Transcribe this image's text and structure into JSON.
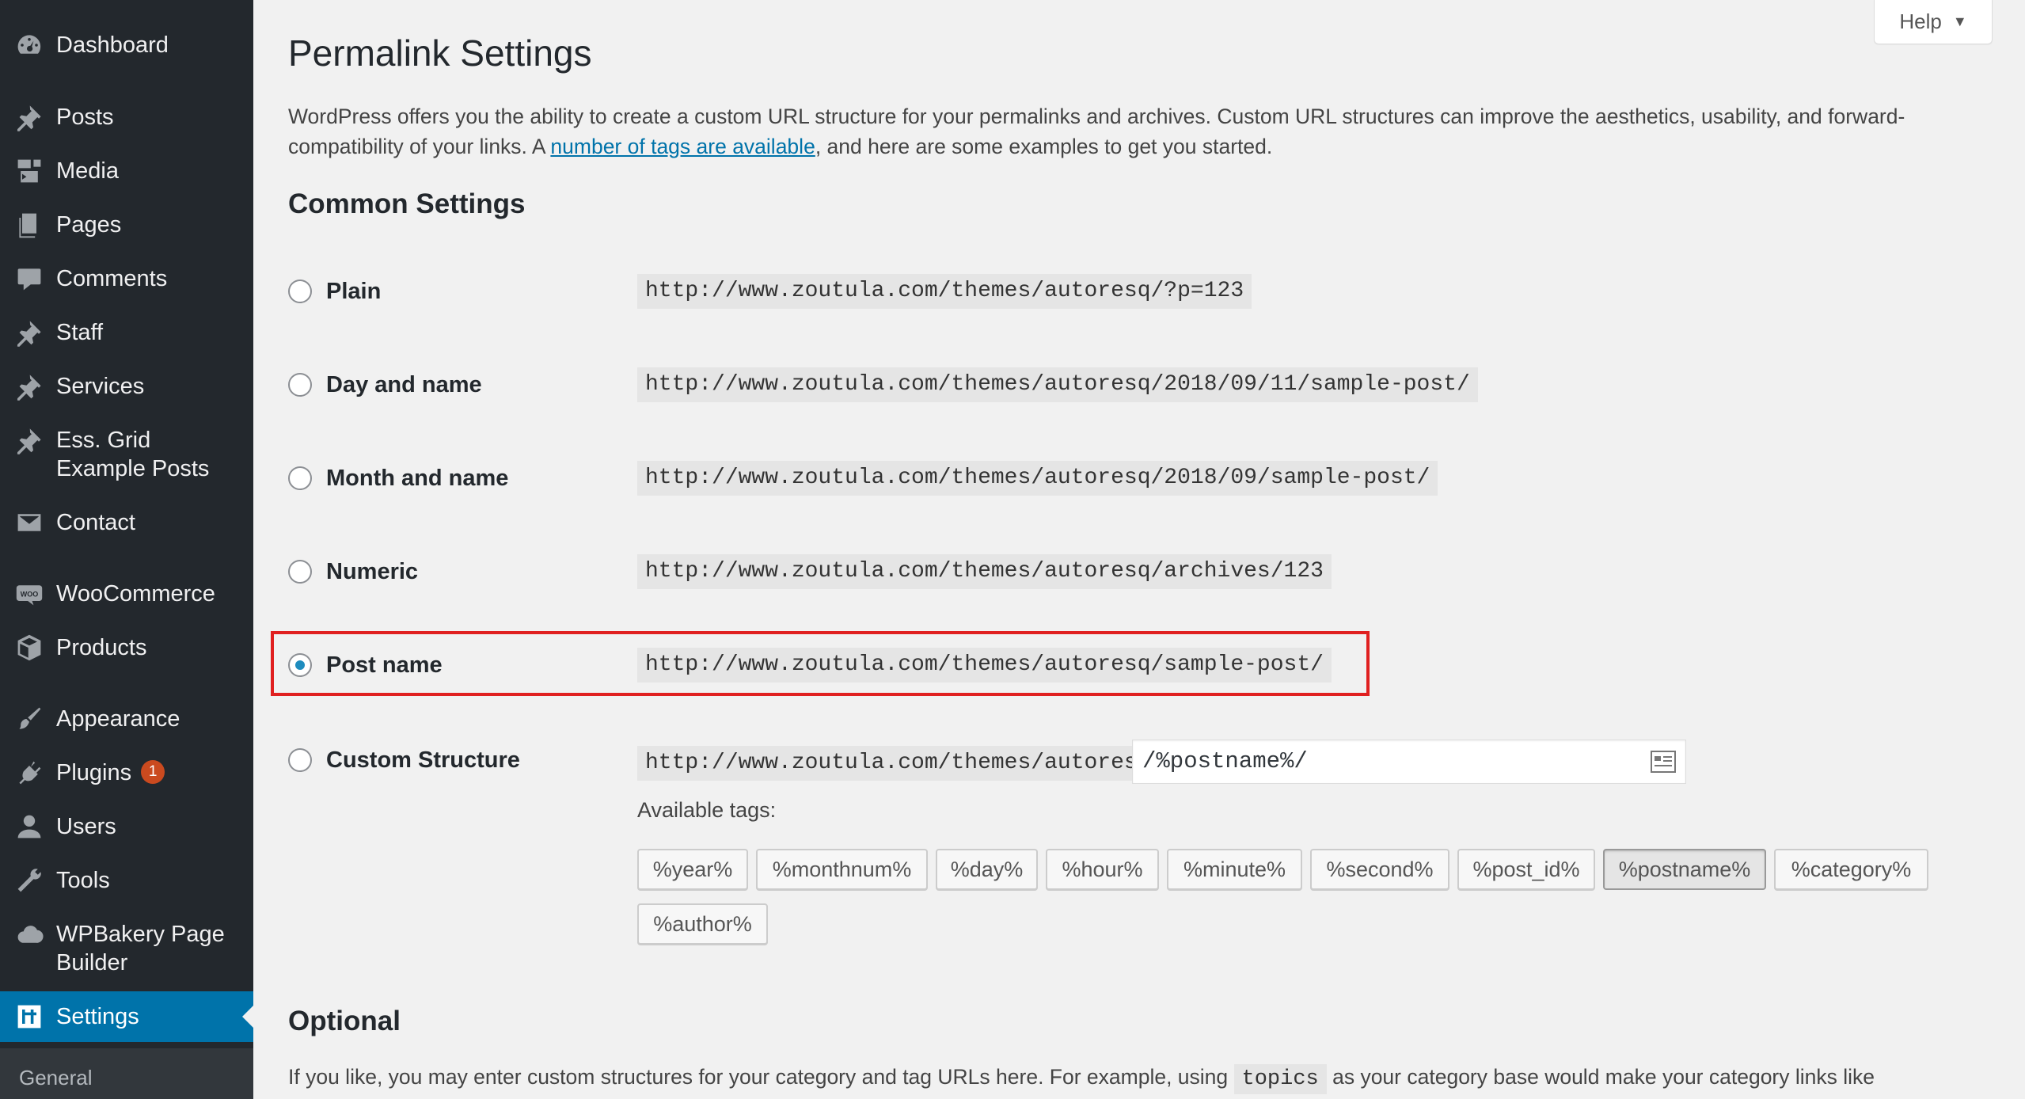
{
  "sidebar": {
    "items": [
      {
        "label": "Dashboard",
        "icon": "dashboard-icon"
      },
      {
        "label": "Posts",
        "icon": "pin-icon"
      },
      {
        "label": "Media",
        "icon": "media-icon"
      },
      {
        "label": "Pages",
        "icon": "pages-icon"
      },
      {
        "label": "Comments",
        "icon": "comment-icon"
      },
      {
        "label": "Staff",
        "icon": "pin-icon"
      },
      {
        "label": "Services",
        "icon": "pin-icon"
      },
      {
        "label": "Ess. Grid Example Posts",
        "icon": "pin-icon"
      },
      {
        "label": "Contact",
        "icon": "mail-icon"
      },
      {
        "label": "WooCommerce",
        "icon": "woo-icon"
      },
      {
        "label": "Products",
        "icon": "box-icon"
      },
      {
        "label": "Appearance",
        "icon": "brush-icon"
      },
      {
        "label": "Plugins",
        "icon": "plug-icon",
        "badge": "1"
      },
      {
        "label": "Users",
        "icon": "user-icon"
      },
      {
        "label": "Tools",
        "icon": "wrench-icon"
      },
      {
        "label": "WPBakery Page Builder",
        "icon": "cloud-icon"
      },
      {
        "label": "Settings",
        "icon": "settings-icon",
        "current": true
      }
    ],
    "submenu": [
      "General"
    ]
  },
  "header": {
    "help_label": "Help",
    "title": "Permalink Settings"
  },
  "intro": {
    "text_before": "WordPress offers you the ability to create a custom URL structure for your permalinks and archives. Custom URL structures can improve the aesthetics, usability, and forward-compatibility of your links. A ",
    "link": "number of tags are available",
    "text_after": ", and here are some examples to get you started."
  },
  "common": {
    "heading": "Common Settings",
    "options": [
      {
        "label": "Plain",
        "example": "http://www.zoutula.com/themes/autoresq/?p=123",
        "checked": false
      },
      {
        "label": "Day and name",
        "example": "http://www.zoutula.com/themes/autoresq/2018/09/11/sample-post/",
        "checked": false
      },
      {
        "label": "Month and name",
        "example": "http://www.zoutula.com/themes/autoresq/2018/09/sample-post/",
        "checked": false
      },
      {
        "label": "Numeric",
        "example": "http://www.zoutula.com/themes/autoresq/archives/123",
        "checked": false
      },
      {
        "label": "Post name",
        "example": "http://www.zoutula.com/themes/autoresq/sample-post/",
        "checked": true
      },
      {
        "label": "Custom Structure",
        "example": "http://www.zoutula.com/themes/autoresq",
        "checked": false
      }
    ],
    "custom_value": "/%postname%/",
    "available_tags_label": "Available tags:",
    "tags": [
      "%year%",
      "%monthnum%",
      "%day%",
      "%hour%",
      "%minute%",
      "%second%",
      "%post_id%",
      "%postname%",
      "%category%",
      "%author%"
    ],
    "active_tag": "%postname%"
  },
  "optional": {
    "heading": "Optional",
    "text_before": "If you like, you may enter custom structures for your category and tag URLs here. For example, using ",
    "code": "topics",
    "text_after": " as your category base would make your category links like"
  },
  "colors": {
    "sidebar_bg": "#23282d",
    "current_bg": "#0073aa",
    "link": "#0073aa",
    "highlight_border": "#e02020",
    "badge": "#ca4a1f"
  }
}
